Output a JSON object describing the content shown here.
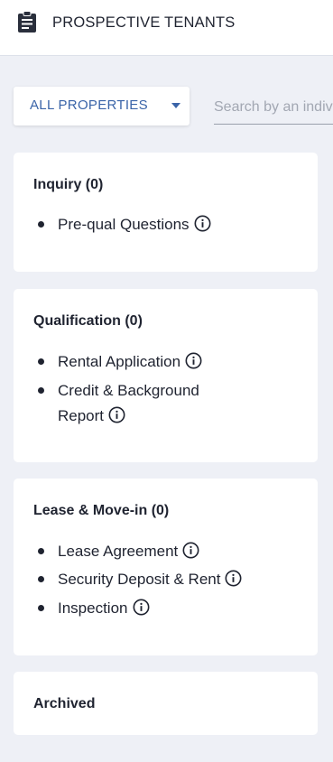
{
  "header": {
    "icon": "clipboard-icon",
    "title": "PROSPECTIVE TENANTS"
  },
  "filter": {
    "label": "ALL PROPERTIES",
    "icon": "caret-down-icon"
  },
  "search": {
    "placeholder": "Search by an individual"
  },
  "cards": [
    {
      "title": "Inquiry (0)",
      "items": [
        {
          "label": "Pre-qual Questions",
          "icon": "info-icon"
        }
      ]
    },
    {
      "title": "Qualification (0)",
      "items": [
        {
          "label": "Rental Application",
          "icon": "info-icon"
        },
        {
          "label_line1": "Credit & Background",
          "label_line2": "Report",
          "icon": "info-icon"
        }
      ]
    },
    {
      "title": "Lease & Move-in (0)",
      "items": [
        {
          "label": "Lease Agreement",
          "icon": "info-icon"
        },
        {
          "label": "Security Deposit & Rent",
          "icon": "info-icon"
        },
        {
          "label": "Inspection",
          "icon": "info-icon"
        }
      ]
    },
    {
      "title": "Archived",
      "items": []
    }
  ],
  "colors": {
    "accent": "#3a64a8",
    "background": "#eef0f6",
    "card": "#ffffff",
    "text": "#1f2330"
  }
}
